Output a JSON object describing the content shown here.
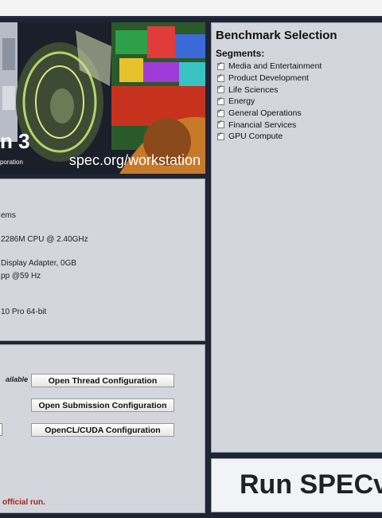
{
  "banner": {
    "product_fragment": "n 3",
    "org_fragment": "poration",
    "url": "spec.org/workstation"
  },
  "system_info": {
    "lines": [
      "ems",
      "2286M CPU @ 2.40GHz",
      "Display Adapter, 0GB",
      "pp @59 Hz",
      "10 Pro 64-bit"
    ]
  },
  "config": {
    "available_fragment": "ailable",
    "buttons": [
      "Open Thread Configuration",
      "Open Submission Configuration",
      "OpenCL/CUDA Configuration"
    ],
    "warning_fragment": "official run."
  },
  "benchmark": {
    "title": "Benchmark Selection",
    "segments_label": "Segments:",
    "segments": [
      {
        "label": "Media and Entertainment",
        "checked": true
      },
      {
        "label": "Product Development",
        "checked": true
      },
      {
        "label": "Life Sciences",
        "checked": true
      },
      {
        "label": "Energy",
        "checked": true
      },
      {
        "label": "General Operations",
        "checked": true
      },
      {
        "label": "Financial Services",
        "checked": true
      },
      {
        "label": "GPU Compute",
        "checked": true
      }
    ]
  },
  "run_button": {
    "label_fragment": "Run SPECv"
  }
}
